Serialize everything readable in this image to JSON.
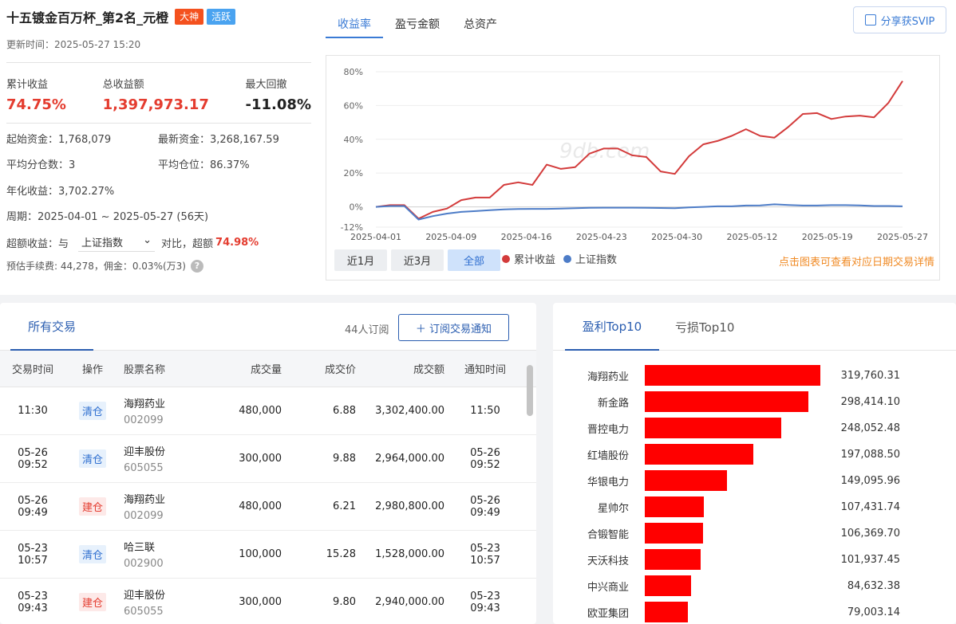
{
  "header": {
    "title": "十五镀金百万杯_第2名_元橙",
    "badges": [
      "大神",
      "活跃"
    ],
    "update_time": "更新时间：2025-05-27 15:20"
  },
  "metrics": [
    {
      "label": "累计收益",
      "value": "74.75%"
    },
    {
      "label": "总收益额",
      "value": "1,397,973.17"
    },
    {
      "label": "最大回撤",
      "value": "-11.08%"
    }
  ],
  "info": {
    "initial_capital": "起始资金：1,768,079",
    "latest_capital": "最新资金：3,268,167.59",
    "avg_positions": "平均分仓数：3",
    "avg_position_ratio": "平均仓位：86.37%",
    "annual_return": "年化收益：3,702.27%",
    "period": "周期：2025-04-01 ~ 2025-05-27 (56天)",
    "excess_prefix": "超额收益：",
    "excess_with": "与",
    "benchmark": "上证指数",
    "excess_compare": "对比，超额",
    "excess_value": "74.98%",
    "fee": "预估手续费: 44,278，佣金：0.03%(万3)"
  },
  "chart_tabs": [
    "收益率",
    "盈亏金额",
    "总资产"
  ],
  "share_label": "分享获SVIP",
  "range_buttons": [
    "近1月",
    "近3月",
    "全部"
  ],
  "chart_tip": "点击图表可查看对应日期交易详情",
  "watermark": "9db.com",
  "chart_data": {
    "type": "line",
    "x_ticks": [
      "2025-04-01",
      "2025-04-09",
      "2025-04-16",
      "2025-04-23",
      "2025-04-30",
      "2025-05-12",
      "2025-05-19",
      "2025-05-27"
    ],
    "y_ticks": [
      "80%",
      "60%",
      "40%",
      "20%",
      "0%",
      "-12%"
    ],
    "ylim": [
      -12,
      80
    ],
    "legend_placement": "bottom",
    "series": [
      {
        "name": "累计收益",
        "color": "#d33b3b",
        "values": [
          0,
          1,
          1,
          -7,
          -3,
          -1,
          4,
          5.5,
          5.5,
          13,
          14.5,
          13,
          25,
          22.5,
          23.5,
          31.5,
          34.5,
          34.5,
          30.5,
          29.5,
          21,
          19.5,
          30,
          37,
          39,
          42,
          46,
          42,
          41,
          47.5,
          55,
          55.5,
          52,
          53.5,
          54,
          53,
          61.5,
          74.5
        ]
      },
      {
        "name": "上证指数",
        "color": "#4d7cc7",
        "values": [
          0,
          0.5,
          0.5,
          -7.5,
          -5.5,
          -4,
          -3,
          -2.5,
          -2,
          -1.5,
          -1.3,
          -1.2,
          -1.2,
          -1,
          -0.8,
          -0.6,
          -0.5,
          -0.5,
          -0.5,
          -0.6,
          -0.7,
          -0.8,
          -0.3,
          0,
          0.3,
          0.3,
          0.8,
          0.9,
          1.5,
          1.1,
          0.8,
          0.8,
          1,
          1,
          0.9,
          0.5,
          0.5,
          0.3
        ]
      }
    ]
  },
  "trades": {
    "tab_label": "所有交易",
    "subscribers": "44人订阅",
    "subscribe_label": "＋ 订阅交易通知",
    "columns": [
      "交易时间",
      "操作",
      "股票名称",
      "成交量",
      "成交价",
      "成交额",
      "通知时间"
    ],
    "rows": [
      {
        "time": "11:30",
        "date": "",
        "op": "清仓",
        "op_type": "clear",
        "name": "海翔药业",
        "code": "002099",
        "volume": "480,000",
        "price": "6.88",
        "amount": "3,302,400.00",
        "notify_date": "",
        "notify_time": "11:50"
      },
      {
        "time": "09:52",
        "date": "05-26",
        "op": "清仓",
        "op_type": "clear",
        "name": "迎丰股份",
        "code": "605055",
        "volume": "300,000",
        "price": "9.88",
        "amount": "2,964,000.00",
        "notify_date": "05-26",
        "notify_time": "09:52"
      },
      {
        "time": "09:49",
        "date": "05-26",
        "op": "建仓",
        "op_type": "build",
        "name": "海翔药业",
        "code": "002099",
        "volume": "480,000",
        "price": "6.21",
        "amount": "2,980,800.00",
        "notify_date": "05-26",
        "notify_time": "09:49"
      },
      {
        "time": "10:57",
        "date": "05-23",
        "op": "清仓",
        "op_type": "clear",
        "name": "哈三联",
        "code": "002900",
        "volume": "100,000",
        "price": "15.28",
        "amount": "1,528,000.00",
        "notify_date": "05-23",
        "notify_time": "10:57"
      },
      {
        "time": "09:43",
        "date": "05-23",
        "op": "建仓",
        "op_type": "build",
        "name": "迎丰股份",
        "code": "605055",
        "volume": "300,000",
        "price": "9.80",
        "amount": "2,940,000.00",
        "notify_date": "05-23",
        "notify_time": "09:43"
      }
    ]
  },
  "top10": {
    "tab_profit": "盈利Top10",
    "tab_loss": "亏损Top10",
    "items": [
      {
        "name": "海翔药业",
        "value": 319760.31,
        "label": "319,760.31"
      },
      {
        "name": "新金路",
        "value": 298414.1,
        "label": "298,414.10"
      },
      {
        "name": "晋控电力",
        "value": 248052.48,
        "label": "248,052.48"
      },
      {
        "name": "红墙股份",
        "value": 197088.5,
        "label": "197,088.50"
      },
      {
        "name": "华银电力",
        "value": 149095.96,
        "label": "149,095.96"
      },
      {
        "name": "星帅尔",
        "value": 107431.74,
        "label": "107,431.74"
      },
      {
        "name": "合锻智能",
        "value": 106369.7,
        "label": "106,369.70"
      },
      {
        "name": "天沃科技",
        "value": 101937.45,
        "label": "101,937.45"
      },
      {
        "name": "中兴商业",
        "value": 84632.38,
        "label": "84,632.38"
      },
      {
        "name": "欧亚集团",
        "value": 79003.14,
        "label": "79,003.14"
      }
    ]
  }
}
